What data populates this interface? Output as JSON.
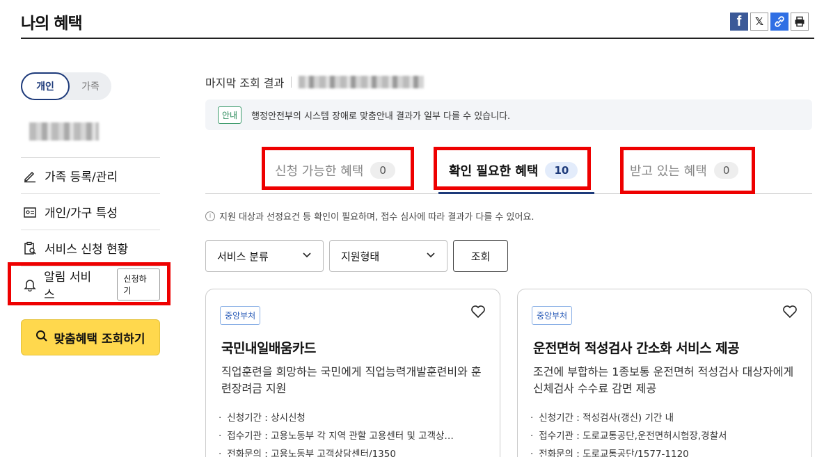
{
  "header": {
    "title": "나의 혜택",
    "share": {
      "facebook": "f",
      "x": "𝕏",
      "link": "🔗",
      "print": "🖶"
    }
  },
  "sidebar": {
    "toggle": {
      "personal": "개인",
      "family": "가족"
    },
    "menu": [
      {
        "label": "가족 등록/관리"
      },
      {
        "label": "개인/가구 특성"
      },
      {
        "label": "서비스 신청 현황"
      },
      {
        "label": "알림 서비스",
        "button": "신청하기"
      }
    ],
    "cta": "맞춤혜택 조회하기"
  },
  "main": {
    "last_lookup": "마지막 조회 결과",
    "notice": {
      "tag": "안내",
      "text": "행정안전부의 시스템 장애로 맞춤안내 결과가 일부 다를 수 있습니다."
    },
    "tabs": [
      {
        "label": "신청 가능한 혜택",
        "count": "0"
      },
      {
        "label": "확인 필요한 혜택",
        "count": "10"
      },
      {
        "label": "받고 있는 혜택",
        "count": "0"
      }
    ],
    "info": "지원 대상과 선정요건 등 확인이 필요하며, 접수 심사에 따라 결과가 다를 수 있어요.",
    "filters": {
      "category": "서비스 분류",
      "type": "지원형태",
      "search": "조회"
    },
    "cards": [
      {
        "badge": "중앙부처",
        "title": "국민내일배움카드",
        "desc": "직업훈련을 희망하는 국민에게 직업능력개발훈련비와 훈련장려금 지원",
        "details": [
          "신청기간 : 상시신청",
          "접수기관 : 고용노동부 각 지역 관할 고용센터 및 고객상…",
          "전화문의 : 고용노동부 고객상담센터/1350"
        ]
      },
      {
        "badge": "중앙부처",
        "title": "운전면허 적성검사 간소화 서비스 제공",
        "desc": "조건에 부합하는 1종보통 운전면허 적성검사 대상자에게 신체검사 수수료 감면 제공",
        "details": [
          "신청기간 : 적성검사(갱신) 기간 내",
          "접수기관 : 도로교통공단,운전면허시험장,경찰서",
          "전화문의 : 도로교통공단/1577-1120"
        ]
      }
    ]
  },
  "colors": {
    "accent": "#1d3a7a",
    "cta": "#ffd84d",
    "highlight": "#e00000"
  }
}
